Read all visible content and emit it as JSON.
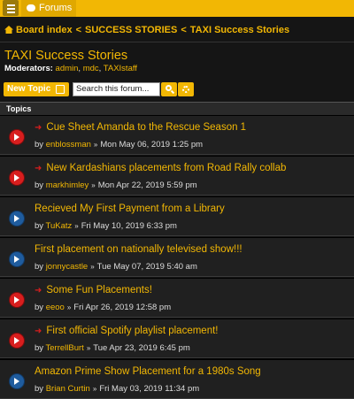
{
  "topbar": {
    "forums_label": "Forums"
  },
  "breadcrumb": {
    "items": [
      "Board index",
      "SUCCESS STORIES",
      "TAXI Success Stories"
    ],
    "separator": "<"
  },
  "page": {
    "title": "TAXI Success Stories",
    "moderators_label": "Moderators:",
    "moderators": [
      "admin",
      "mdc",
      "TAXIstaff"
    ]
  },
  "actions": {
    "new_topic_label": "New Topic",
    "search_placeholder": "Search this forum..."
  },
  "topics_header": "Topics",
  "topics": [
    {
      "title": "Cue Sheet Amanda to the Rescue Season 1",
      "author": "enblossman",
      "date": "Mon May 06, 2019 1:25 pm",
      "hot": true
    },
    {
      "title": "New Kardashians placements from Road Rally collab",
      "author": "markhimley",
      "date": "Mon Apr 22, 2019 5:59 pm",
      "hot": true
    },
    {
      "title": "Recieved My First Payment from a Library",
      "author": "TuKatz",
      "date": "Fri May 10, 2019 6:33 pm",
      "hot": false
    },
    {
      "title": "First placement on nationally televised show!!!",
      "author": "jonnycastle",
      "date": "Tue May 07, 2019 5:40 am",
      "hot": false
    },
    {
      "title": "Some Fun Placements!",
      "author": "eeoo",
      "date": "Fri Apr 26, 2019 12:58 pm",
      "hot": true
    },
    {
      "title": "First official Spotify playlist placement!",
      "author": "TerrellBurt",
      "date": "Tue Apr 23, 2019 6:45 pm",
      "hot": true
    },
    {
      "title": "Amazon Prime Show Placement for a 1980s Song",
      "author": "Brian Curtin",
      "date": "Fri May 03, 2019 11:34 pm",
      "hot": false
    }
  ],
  "labels": {
    "by": "by",
    "chevron": "»"
  },
  "colors": {
    "accent": "#f2b704",
    "hot_icon": "#d81e1e",
    "normal_icon": "#1f5c9e",
    "background": "#151515"
  }
}
